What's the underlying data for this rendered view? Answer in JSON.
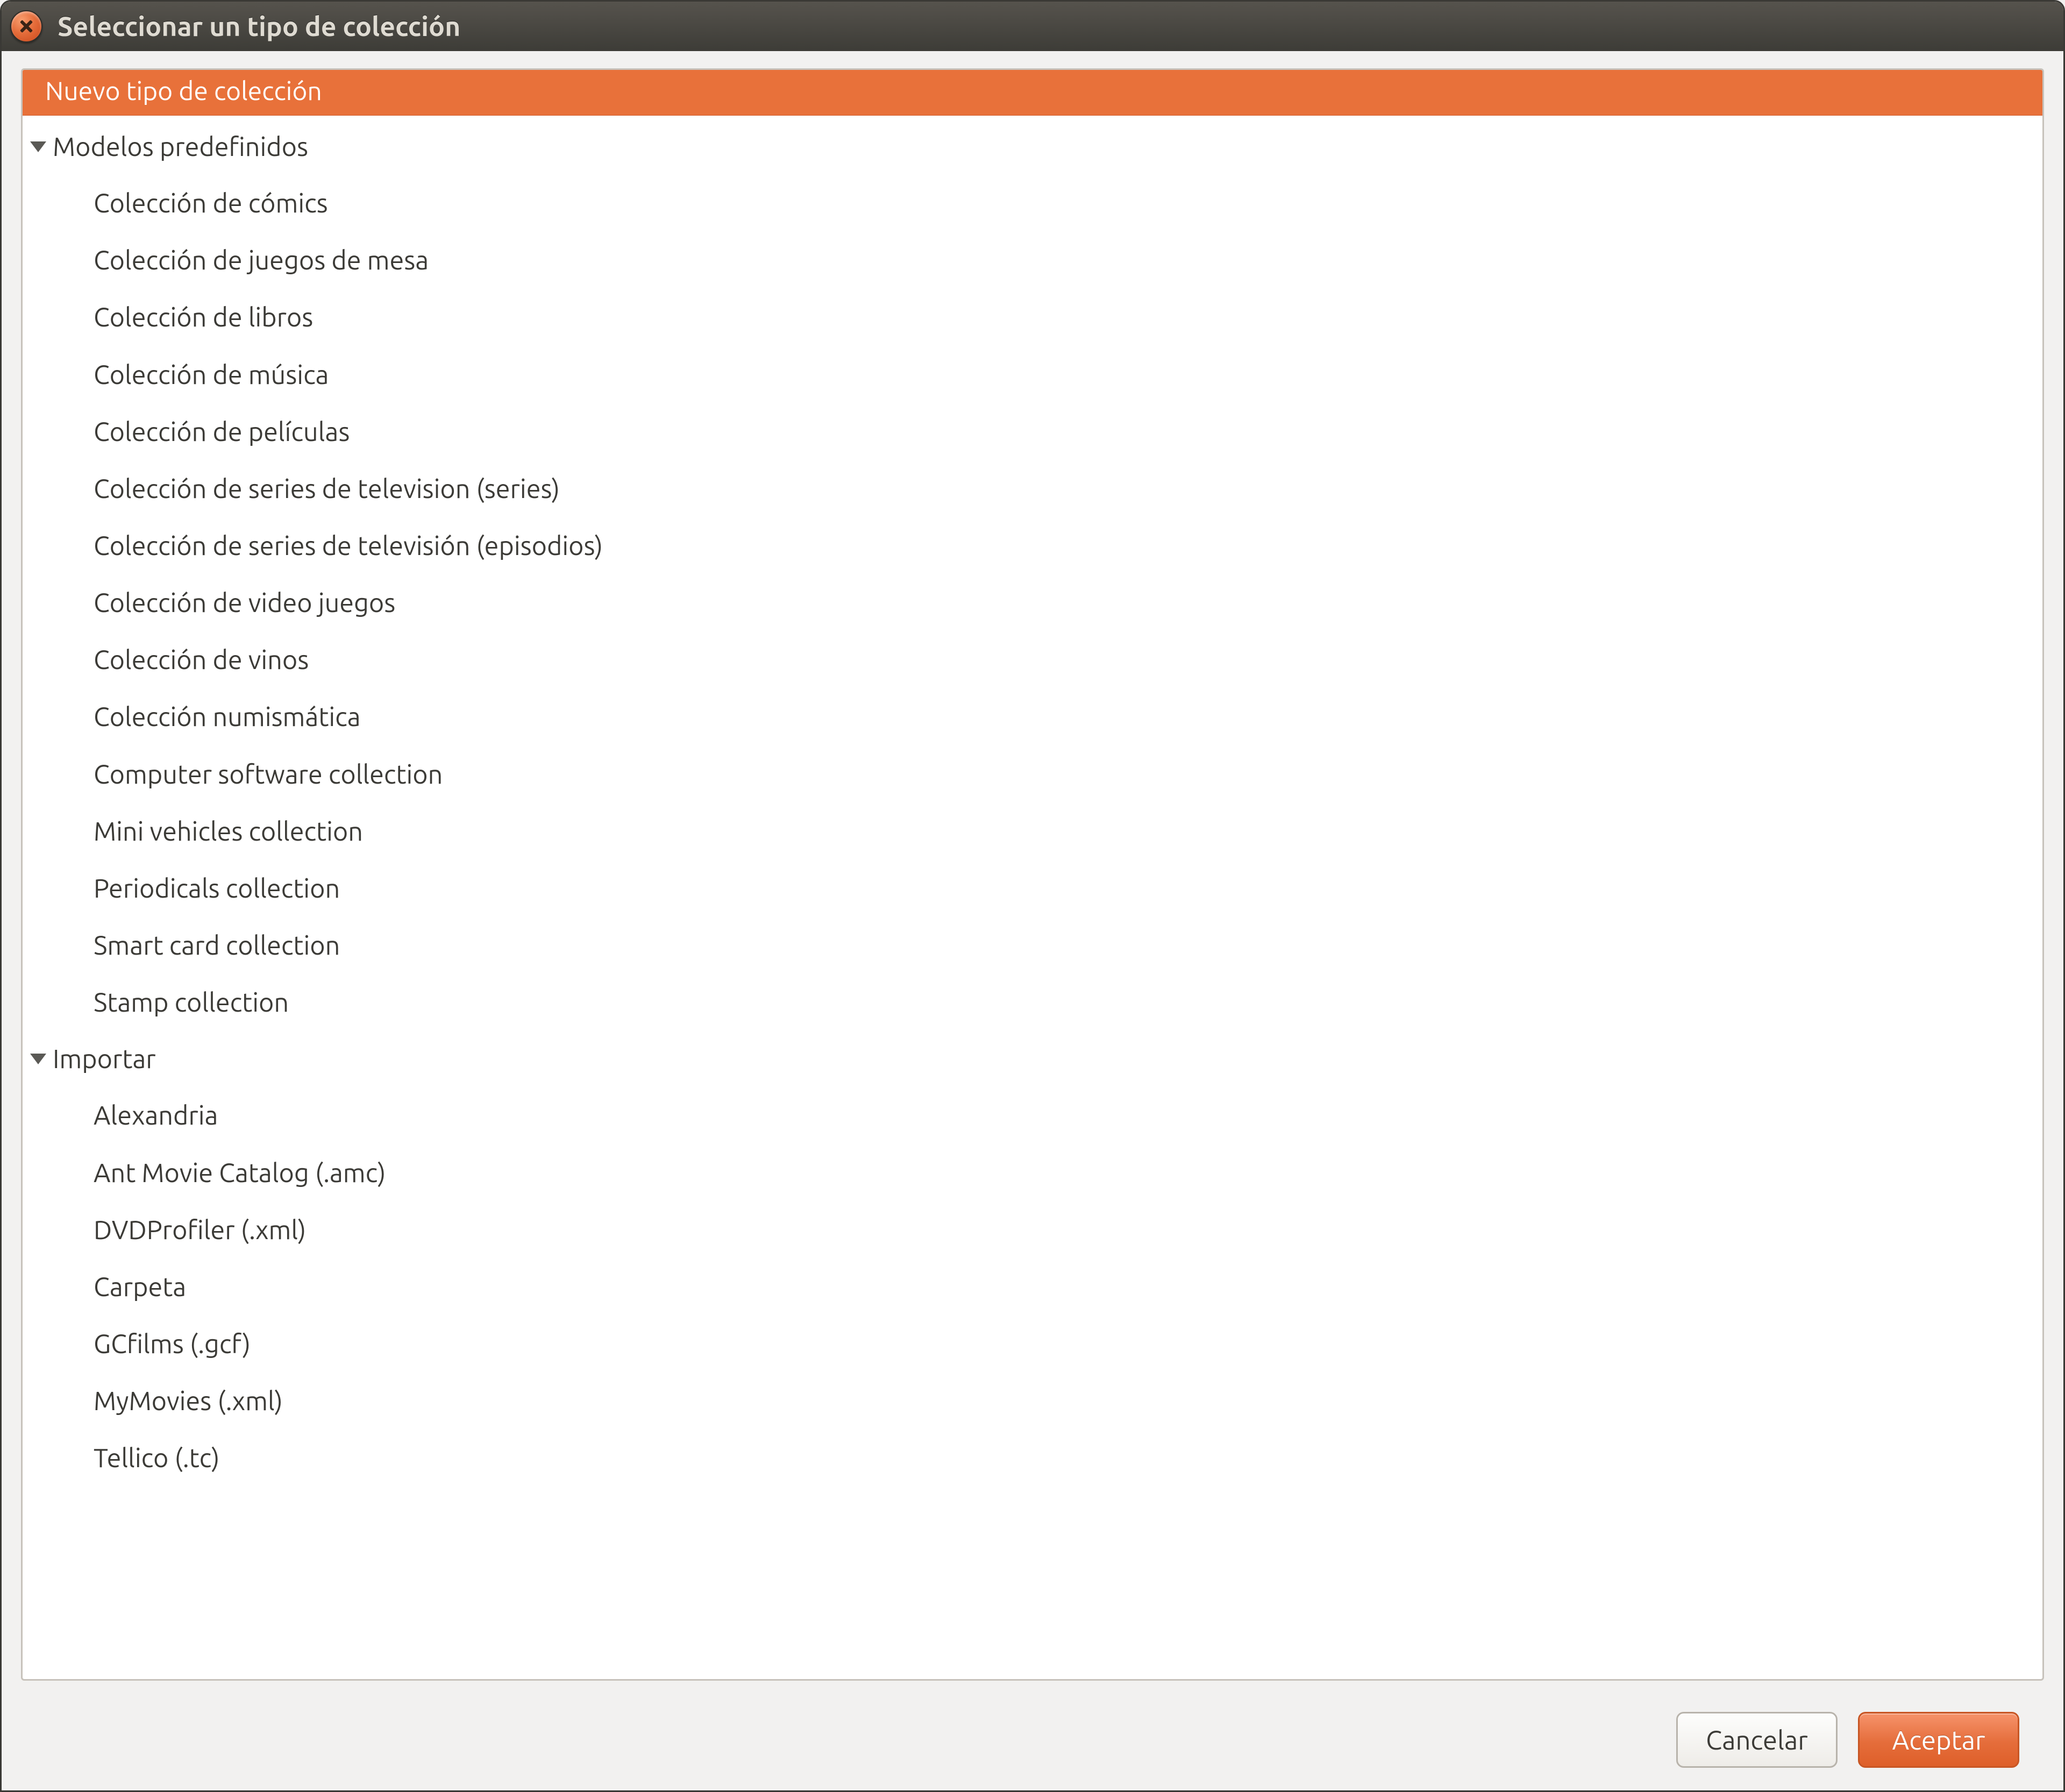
{
  "window": {
    "title": "Seleccionar un tipo de colección"
  },
  "tree": {
    "header": "Nuevo tipo de colección",
    "group_models": {
      "label": "Modelos predefinidos",
      "items": [
        "Colección de cómics",
        "Colección de juegos de mesa",
        "Colección de libros",
        "Colección de música",
        "Colección de películas",
        "Colección de series de television (series)",
        "Colección de series de televisión (episodios)",
        "Colección de video juegos",
        "Colección de vinos",
        "Colección numismática",
        "Computer software collection",
        "Mini vehicles collection",
        "Periodicals collection",
        "Smart card collection",
        "Stamp collection"
      ]
    },
    "group_import": {
      "label": "Importar",
      "items": [
        "Alexandria",
        "Ant Movie Catalog (.amc)",
        "DVDProfiler (.xml)",
        "Carpeta",
        "GCfilms (.gcf)",
        "MyMovies (.xml)",
        "Tellico (.tc)"
      ]
    }
  },
  "buttons": {
    "cancel": "Cancelar",
    "accept": "Aceptar"
  }
}
